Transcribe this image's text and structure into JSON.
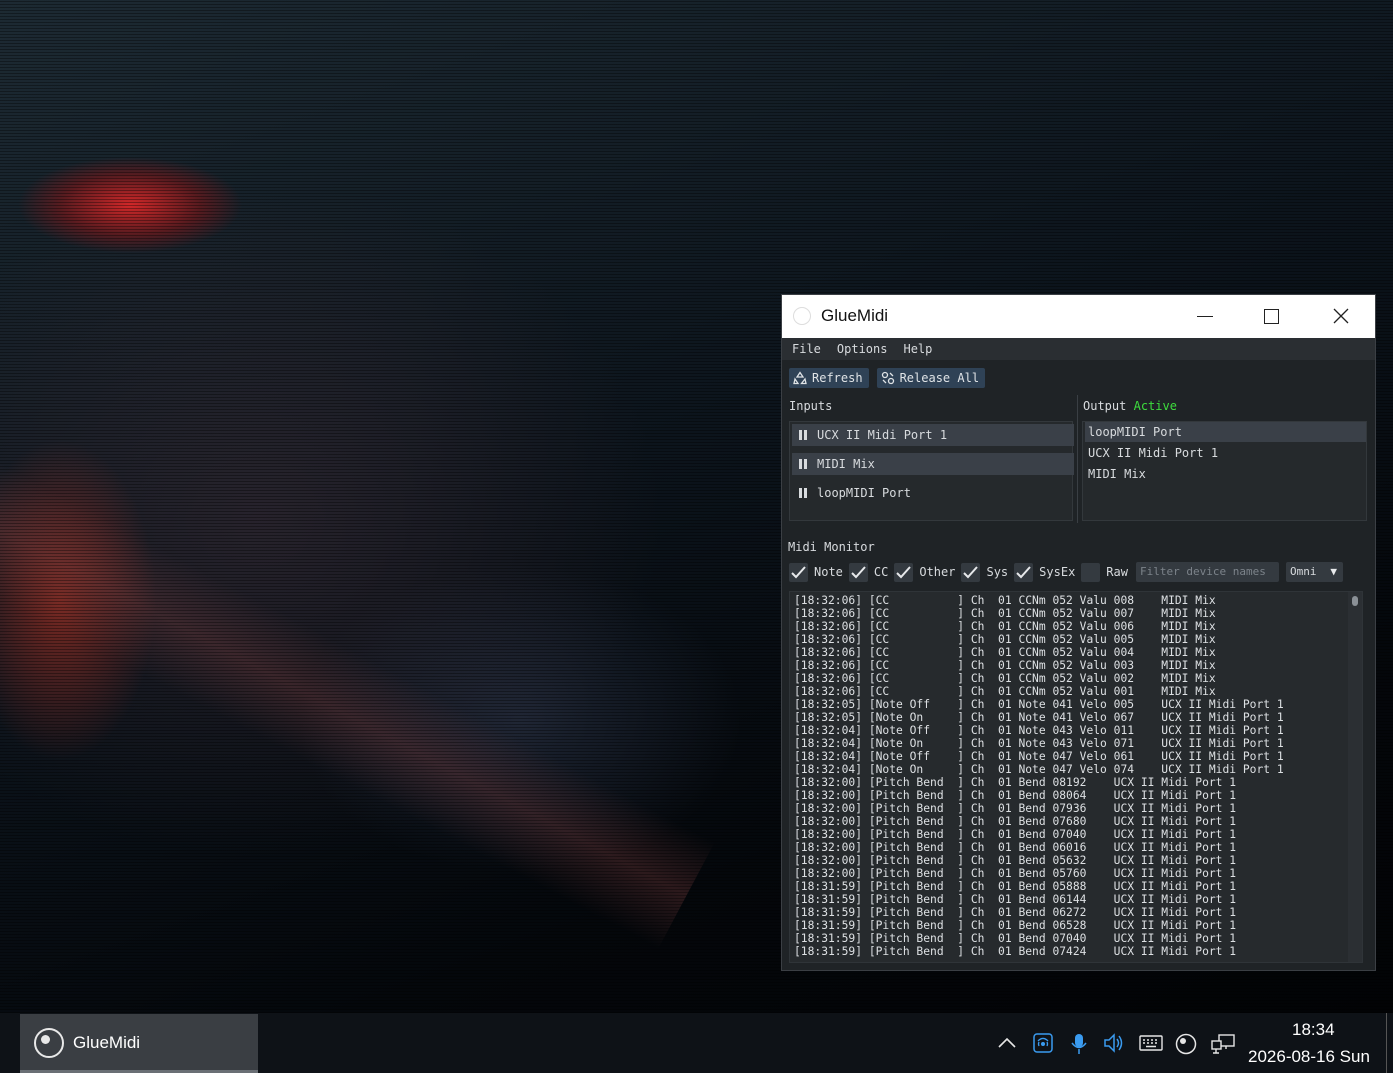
{
  "window": {
    "title": "GlueMidi",
    "menu": [
      "File",
      "Options",
      "Help"
    ],
    "toolbar": {
      "refresh_label": "Refresh",
      "release_label": "Release All"
    },
    "inputs": {
      "label": "Inputs",
      "items": [
        {
          "name": "UCX II Midi Port 1",
          "state": "paused"
        },
        {
          "name": "MIDI Mix",
          "state": "paused"
        },
        {
          "name": "loopMIDI Port",
          "state": "paused"
        }
      ]
    },
    "output": {
      "label": "Output",
      "status": "Active",
      "items": [
        "loopMIDI Port",
        "UCX II Midi Port 1",
        "MIDI Mix"
      ]
    },
    "monitor": {
      "label": "Midi Monitor",
      "filters": [
        {
          "label": "Note",
          "checked": true
        },
        {
          "label": "CC",
          "checked": true
        },
        {
          "label": "Other",
          "checked": true
        },
        {
          "label": "Sys",
          "checked": true
        },
        {
          "label": "SysEx",
          "checked": true
        },
        {
          "label": "Raw",
          "checked": false
        }
      ],
      "device_filter_placeholder": "Filter device names",
      "channel_select": "Omni",
      "log": [
        "[18:32:06] [CC          ] Ch  01 CCNm 052 Valu 008    MIDI Mix",
        "[18:32:06] [CC          ] Ch  01 CCNm 052 Valu 007    MIDI Mix",
        "[18:32:06] [CC          ] Ch  01 CCNm 052 Valu 006    MIDI Mix",
        "[18:32:06] [CC          ] Ch  01 CCNm 052 Valu 005    MIDI Mix",
        "[18:32:06] [CC          ] Ch  01 CCNm 052 Valu 004    MIDI Mix",
        "[18:32:06] [CC          ] Ch  01 CCNm 052 Valu 003    MIDI Mix",
        "[18:32:06] [CC          ] Ch  01 CCNm 052 Valu 002    MIDI Mix",
        "[18:32:06] [CC          ] Ch  01 CCNm 052 Valu 001    MIDI Mix",
        "[18:32:05] [Note Off    ] Ch  01 Note 041 Velo 005    UCX II Midi Port 1",
        "[18:32:05] [Note On     ] Ch  01 Note 041 Velo 067    UCX II Midi Port 1",
        "[18:32:04] [Note Off    ] Ch  01 Note 043 Velo 011    UCX II Midi Port 1",
        "[18:32:04] [Note On     ] Ch  01 Note 043 Velo 071    UCX II Midi Port 1",
        "[18:32:04] [Note Off    ] Ch  01 Note 047 Velo 061    UCX II Midi Port 1",
        "[18:32:04] [Note On     ] Ch  01 Note 047 Velo 074    UCX II Midi Port 1",
        "[18:32:00] [Pitch Bend  ] Ch  01 Bend 08192    UCX II Midi Port 1",
        "[18:32:00] [Pitch Bend  ] Ch  01 Bend 08064    UCX II Midi Port 1",
        "[18:32:00] [Pitch Bend  ] Ch  01 Bend 07936    UCX II Midi Port 1",
        "[18:32:00] [Pitch Bend  ] Ch  01 Bend 07680    UCX II Midi Port 1",
        "[18:32:00] [Pitch Bend  ] Ch  01 Bend 07040    UCX II Midi Port 1",
        "[18:32:00] [Pitch Bend  ] Ch  01 Bend 06016    UCX II Midi Port 1",
        "[18:32:00] [Pitch Bend  ] Ch  01 Bend 05632    UCX II Midi Port 1",
        "[18:32:00] [Pitch Bend  ] Ch  01 Bend 05760    UCX II Midi Port 1",
        "[18:31:59] [Pitch Bend  ] Ch  01 Bend 05888    UCX II Midi Port 1",
        "[18:31:59] [Pitch Bend  ] Ch  01 Bend 06144    UCX II Midi Port 1",
        "[18:31:59] [Pitch Bend  ] Ch  01 Bend 06272    UCX II Midi Port 1",
        "[18:31:59] [Pitch Bend  ] Ch  01 Bend 06528    UCX II Midi Port 1",
        "[18:31:59] [Pitch Bend  ] Ch  01 Bend 07040    UCX II Midi Port 1",
        "[18:31:59] [Pitch Bend  ] Ch  01 Bend 07424    UCX II Midi Port 1"
      ]
    }
  },
  "taskbar": {
    "app_label": "GlueMidi",
    "tray_icons": [
      "chevron-up-icon",
      "wireless-icon",
      "microphone-icon",
      "speaker-icon",
      "keyboard-icon",
      "gluemidi-tray-icon",
      "network-icon"
    ],
    "time": "18:34",
    "date": "2026-08-16 Sun"
  },
  "colors": {
    "window_bg": "#1f2326",
    "button_bg": "#2f4256",
    "active_green": "#3ddc3d",
    "selected_row": "#3a4048",
    "tray_accent": "#3a9bf0"
  }
}
